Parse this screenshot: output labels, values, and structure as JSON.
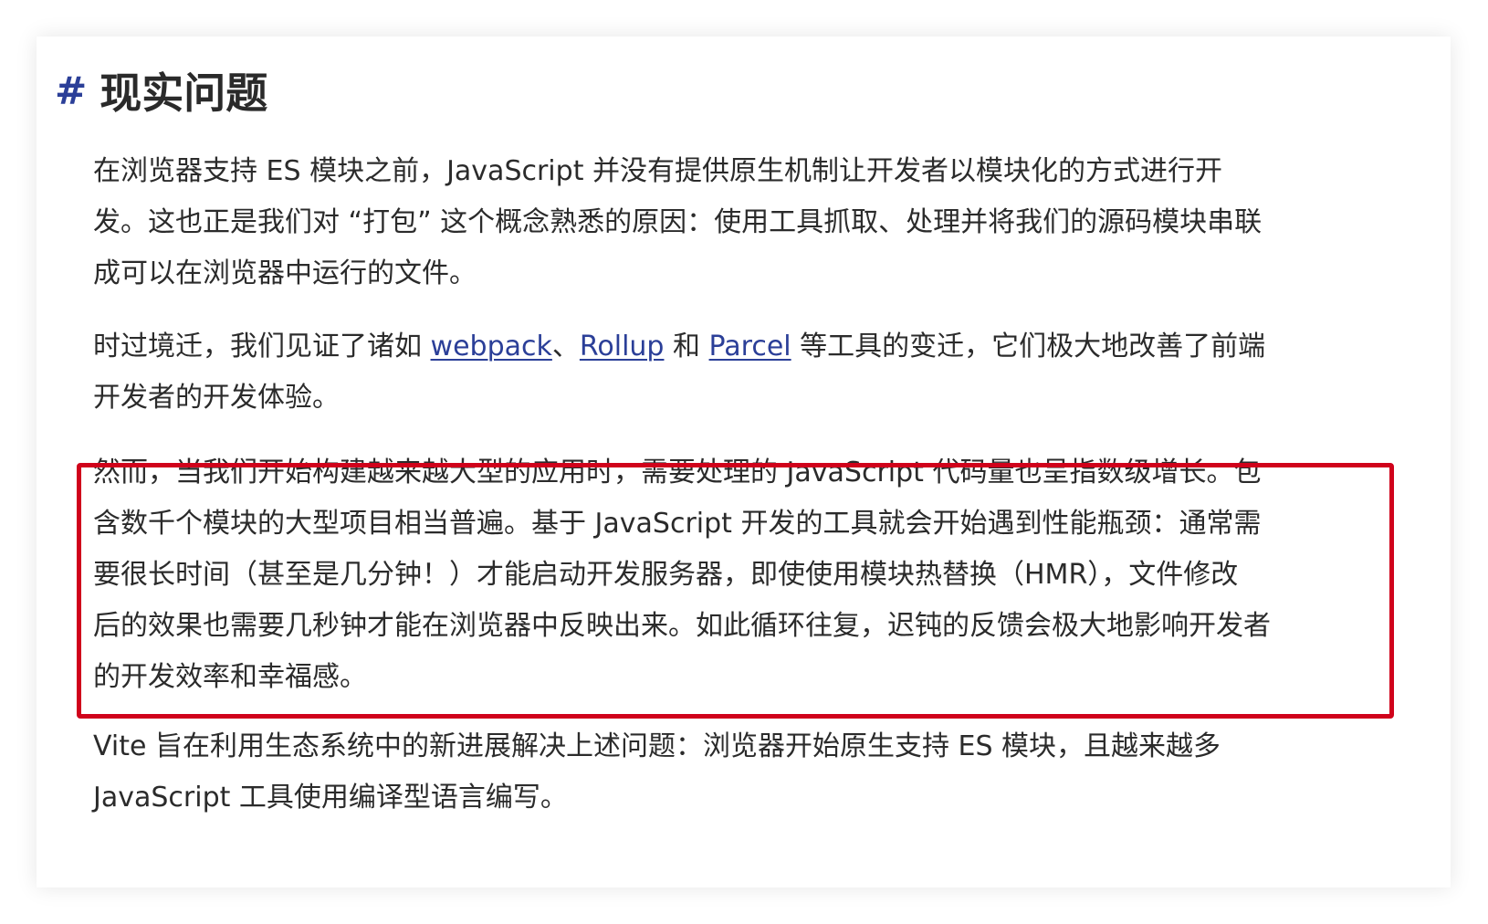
{
  "heading": {
    "hash": "#",
    "title": "现实问题"
  },
  "paragraphs": {
    "p1": {
      "lines": [
        "在浏览器支持 ES 模块之前，JavaScript 并没有提供原生机制让开发者以模块化的方式进行开",
        "发。这也正是我们对 “打包” 这个概念熟悉的原因：使用工具抓取、处理并将我们的源码模块串联",
        "成可以在浏览器中运行的文件。"
      ]
    },
    "p2": {
      "line1_before": "时过境迁，我们见证了诸如 ",
      "link_webpack": "webpack",
      "sep1": "、",
      "link_rollup": "Rollup",
      "sep2": " 和 ",
      "link_parcel": "Parcel",
      "line1_after": " 等工具的变迁，它们极大地改善了前端",
      "line2": "开发者的开发体验。"
    },
    "p3": {
      "lines": [
        "然而，当我们开始构建越来越大型的应用时，需要处理的 JavaScript 代码量也呈指数级增长。包",
        "含数千个模块的大型项目相当普遍。基于 JavaScript 开发的工具就会开始遇到性能瓶颈：通常需",
        "要很长时间（甚至是几分钟！）才能启动开发服务器，即使使用模块热替换（HMR），文件修改",
        "后的效果也需要几秒钟才能在浏览器中反映出来。如此循环往复，迟钝的反馈会极大地影响开发者",
        "的开发效率和幸福感。"
      ]
    },
    "p4": {
      "lines": [
        "Vite 旨在利用生态系统中的新进展解决上述问题：浏览器开始原生支持 ES 模块，且越来越多",
        "JavaScript 工具使用编译型语言编写。"
      ]
    }
  },
  "colors": {
    "link": "#2b3f98",
    "highlight_border": "#d0021b",
    "text": "#2b2b2b"
  }
}
